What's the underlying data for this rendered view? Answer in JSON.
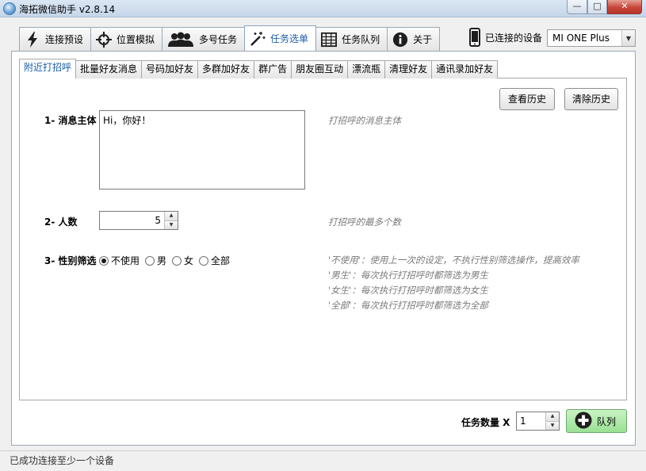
{
  "window": {
    "title": "海拓微信助手 v2.8.14",
    "min_label": "—",
    "max_label": "□",
    "close_label": "✕"
  },
  "top_tabs": [
    {
      "label": "连接预设",
      "icon": "lightning-icon"
    },
    {
      "label": "位置模拟",
      "icon": "crosshair-icon"
    },
    {
      "label": "多号任务",
      "icon": "users-icon"
    },
    {
      "label": "任务选单",
      "icon": "magic-wand-icon",
      "active": true
    },
    {
      "label": "任务队列",
      "icon": "table-icon"
    },
    {
      "label": "关于",
      "icon": "info-icon"
    }
  ],
  "device": {
    "label": "已连接的设备",
    "selected": "MI ONE Plus",
    "icon": "phone-icon"
  },
  "sub_tabs": [
    {
      "label": "附近打招呼",
      "active": true
    },
    {
      "label": "批量好友消息"
    },
    {
      "label": "号码加好友"
    },
    {
      "label": "多群加好友"
    },
    {
      "label": "群广告"
    },
    {
      "label": "朋友圈互动"
    },
    {
      "label": "漂流瓶"
    },
    {
      "label": "清理好友"
    },
    {
      "label": "通讯录加好友"
    }
  ],
  "history": {
    "view_label": "查看历史",
    "clear_label": "清除历史"
  },
  "form": {
    "message": {
      "label": "1- 消息主体",
      "value": "Hi，你好！",
      "hint": "打招呼的消息主体"
    },
    "count": {
      "label": "2- 人数",
      "value": "5",
      "hint": "打招呼的最多个数"
    },
    "gender": {
      "label": "3- 性别筛选",
      "options": [
        "不使用",
        "男",
        "女",
        "全部"
      ],
      "selected": "不使用",
      "hints": [
        "'不使用'：使用上一次的设定，不执行性别筛选操作，提高效率",
        "'男生'：每次执行打招呼时都筛选为男生",
        "'女生'：每次执行打招呼时都筛选为女生",
        "'全部'：每次执行打招呼时都筛选为全部"
      ]
    }
  },
  "queue": {
    "count_label": "任务数量 X",
    "count_value": "1",
    "button_label": "队列",
    "button_color": "#9ae093"
  },
  "status": {
    "text": "已成功连接至少一个设备"
  }
}
